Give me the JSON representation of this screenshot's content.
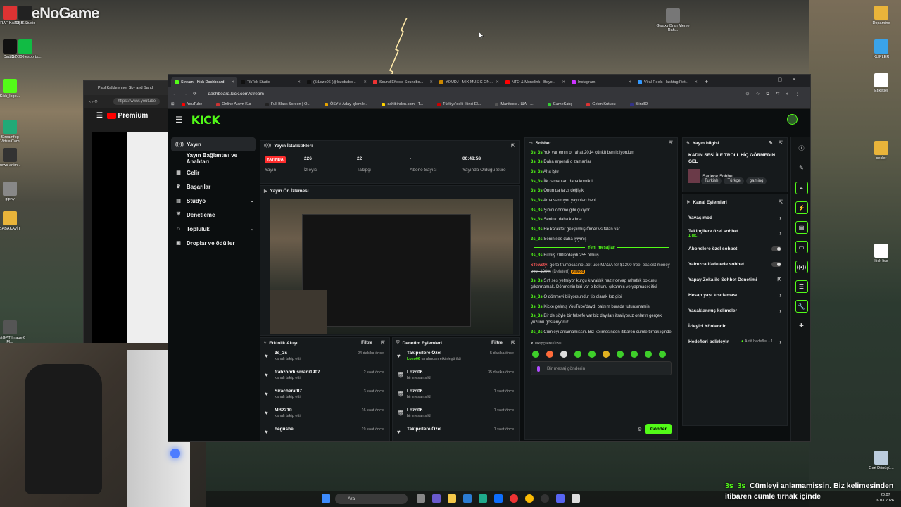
{
  "watermark": "BeNoGame",
  "desktop": {
    "left_icons": [
      {
        "label": "ETRAF KARIŞIK",
        "color": "#d33"
      },
      {
        "label": "OBS Studio",
        "color": "#222"
      },
      {
        "label": "CapCut",
        "color": "#111"
      },
      {
        "label": "LOZO06 esports...",
        "color": "#1b4"
      },
      {
        "label": "Kick_logo...",
        "color": "#53fc18"
      },
      {
        "label": "Streamfog VirtualCam",
        "color": "#2a7"
      },
      {
        "label": "news-anim...",
        "color": "#333"
      },
      {
        "label": "giphy",
        "color": "#888"
      },
      {
        "label": "BABAKAVİT",
        "color": "#e9b43a"
      },
      {
        "label": "ChatGPT Image 6 M...",
        "color": "#555"
      }
    ],
    "right_icons": [
      {
        "label": "Dopamine",
        "color": "#e9b43a"
      },
      {
        "label": "KLIPLER",
        "color": "#3aa3e9"
      },
      {
        "label": "Etiketler",
        "color": "#fff"
      },
      {
        "label": "sesler",
        "color": "#e9b43a"
      },
      {
        "label": "kick live",
        "color": "#fff"
      },
      {
        "label": "Geri Dönüşü...",
        "color": "#bcd"
      }
    ],
    "top_icon": "Galaxy Bran Meme Rah..."
  },
  "back_browser": {
    "tab": "Paul Kalkbrenner Sky and Sand",
    "url": "https://www.youtube",
    "brand": "Premium"
  },
  "browser": {
    "tabs": [
      {
        "label": "Stream - Kick Dashboard",
        "active": true,
        "color": "#53fc18"
      },
      {
        "label": "TikTok Studio",
        "active": false,
        "color": "#111"
      },
      {
        "label": "(5)Lozo06 (@lozobabo...",
        "active": false,
        "color": "#111"
      },
      {
        "label": "Sound Effects Soundbo...",
        "active": false,
        "color": "#e33"
      },
      {
        "label": "YOUDJ - MIX MUSIC ON...",
        "active": false,
        "color": "#c80"
      },
      {
        "label": "NTO & Monolink - Beyo...",
        "active": false,
        "color": "#f00"
      },
      {
        "label": "Instagram",
        "active": false,
        "color": "#c3f"
      },
      {
        "label": "Viral Reels Hashtag Ret...",
        "active": false,
        "color": "#39f"
      }
    ],
    "new_tab": "+",
    "url": "dashboard.kick.com/stream",
    "bookmarks": [
      {
        "label": "YouTube",
        "color": "#f00"
      },
      {
        "label": "Online Alarm Kur",
        "color": "#c33"
      },
      {
        "label": "Full Black Screen | O...",
        "color": "#222"
      },
      {
        "label": "ÖSYM Aday İşlemle...",
        "color": "#e9a500"
      },
      {
        "label": "sahibinden.com - T...",
        "color": "#ffd400"
      },
      {
        "label": "Türkiye'deki İkinci El...",
        "color": "#c00"
      },
      {
        "label": "Manifests / ША - ...",
        "color": "#555"
      },
      {
        "label": "GameSatış",
        "color": "#3c3"
      },
      {
        "label": "Gelen Kutusu",
        "color": "#d33"
      },
      {
        "label": "BlindID",
        "color": "#338"
      }
    ]
  },
  "kick": {
    "logo": "KICK",
    "nav": [
      {
        "label": "Yayın",
        "icon": "((•))",
        "active": true,
        "chevron": ""
      },
      {
        "label": "Yayın Bağlantısı ve Anahtarı",
        "icon": "",
        "active": false,
        "chevron": ""
      },
      {
        "label": "Gelir",
        "icon": "▦",
        "active": false,
        "chevron": ""
      },
      {
        "label": "Başarılar",
        "icon": "♛",
        "active": false,
        "chevron": ""
      },
      {
        "label": "Stüdyo",
        "icon": "▤",
        "active": false,
        "chevron": "⌄"
      },
      {
        "label": "Denetleme",
        "icon": "⛨",
        "active": false,
        "chevron": ""
      },
      {
        "label": "Topluluk",
        "icon": "☺",
        "active": false,
        "chevron": "⌄"
      },
      {
        "label": "Droplar ve ödüller",
        "icon": "▣",
        "active": false,
        "chevron": ""
      }
    ],
    "stats": {
      "title": "Yayın İstatistikleri",
      "live_label": "YAYINDA",
      "items": [
        {
          "value": "226",
          "label": "İzleyici"
        },
        {
          "value": "22",
          "label": "Takipçi"
        },
        {
          "value": "-",
          "label": "Abone Sayısı"
        },
        {
          "value": "00:48:58",
          "label": "Yayında Olduğu Süre"
        }
      ],
      "first_label": "Yayın"
    },
    "preview_title": "Yayın Ön İzlemesi",
    "activity": {
      "title": "Etkinlik Akışı",
      "filter": "Filtre",
      "rows": [
        {
          "name": "3s_3s",
          "sub": "kanalı takip etti",
          "time": "24 dakika önce"
        },
        {
          "name": "trabzondusmani1907",
          "sub": "kanalı takip etti",
          "time": "2 saat önce"
        },
        {
          "name": "Siracberat07",
          "sub": "kanalı takip etti",
          "time": "3 saat önce"
        },
        {
          "name": "MB2210",
          "sub": "kanalı takip etti",
          "time": "16 saat önce"
        },
        {
          "name": "begushe",
          "sub": "",
          "time": "19 saat önce"
        }
      ]
    },
    "moderation": {
      "title": "Denetim Eylemleri",
      "filter": "Filtre",
      "rows": [
        {
          "name": "Takipçilere Özel",
          "by": "Lozo06",
          "sub": "tarafından etkinleştirildi",
          "time": "5 dakika önce",
          "icon": "♥"
        },
        {
          "name": "Lozo06",
          "by": "",
          "sub": "bir mesajı sildi",
          "time": "35 dakika önce",
          "icon": "🗑"
        },
        {
          "name": "Lozo06",
          "by": "",
          "sub": "bir mesajı sildi",
          "time": "1 saat önce",
          "icon": "🗑"
        },
        {
          "name": "Lozo06",
          "by": "",
          "sub": "bir mesajı sildi",
          "time": "1 saat önce",
          "icon": "🗑"
        },
        {
          "name": "Takipçilere Özel",
          "by": "",
          "sub": "",
          "time": "1 saat önce",
          "icon": "♥"
        }
      ]
    },
    "chat": {
      "title": "Sohbet",
      "messages": [
        {
          "user": "3s_3s",
          "text": "Yok var emin ol rahat 2014 çünkü ben izliyordum"
        },
        {
          "user": "3s_3s",
          "text": "Daha ergendi o zamanlar"
        },
        {
          "user": "3s_3s",
          "text": "Aha işte"
        },
        {
          "user": "3s_3s",
          "text": "İlk zamanları daha komikti"
        },
        {
          "user": "3s_3s",
          "text": "Onun da tarzı değişik"
        },
        {
          "user": "3s_3s",
          "text": "Ama sarmıyor yayınları beni"
        },
        {
          "user": "3s_3s",
          "text": "Şimdi dönme gibi çıkıyor"
        },
        {
          "user": "3s_3s",
          "text": "Seninki daha kadırsı"
        },
        {
          "user": "3s_3s",
          "text": "He karakter geliştirmiş Ömer vs falan var"
        },
        {
          "user": "3s_3s",
          "text": "Senin ses daha iyiymiş"
        }
      ],
      "new_messages_label": "Yeni mesajlar",
      "messages2": [
        {
          "user": "3s_3s",
          "text": "Bitmiş 700lerdeydi 255 olmuş"
        }
      ],
      "deleted": {
        "user": "xTewsty:",
        "text": "go to trumpcasino .bet use MAGA for $1200 free, easiest money ever 100%",
        "note": "(Deleted)",
        "tag": "AI Mod"
      },
      "messages3": [
        {
          "user": "3s_3s",
          "text": "Sırf ses yetmiyor kurgu kıvraklık hazır cevap rahatlık bokunu çıkarmamak. Dönmenin biri var o bokunu çıkarmış ve yapmacık iticî"
        },
        {
          "user": "3s_3s",
          "text": "O dönmeyi biliyorsundur tip olarak kız gibi"
        },
        {
          "user": "3s_3s",
          "text": "Kicke gelmiş YouTube'daydı baktım burada tutunsmamis"
        },
        {
          "user": "3s_3s",
          "text": "Bir de şöyle bir felsefe var biz dayıları ifsaliyoruz onların gerçek yüzünü gösteriyoruz"
        },
        {
          "user": "3s_3s",
          "text": "Cümleyi anlamamissin. Biz kelimesinden itibaren cümle tırnak içinde"
        }
      ],
      "followers_only": "Takipçilere Özel",
      "input_placeholder": "Bir mesaj gönderin",
      "send": "Gönder"
    },
    "info": {
      "title": "Yayın bilgisi",
      "stream_title": "KADIN SESİ İLE TROLL HİÇ GÖRMEDİN GEL",
      "category": "Sadece Sohbet",
      "tags": [
        "Turkish",
        "Türkçe",
        "gaming"
      ]
    },
    "actions": {
      "title": "Kanal Eylemleri",
      "items": [
        {
          "label": "Yavaş mod",
          "sub": "",
          "control": "arrow",
          "side": ""
        },
        {
          "label": "Takipçilere özel sohbet",
          "sub": "1 dk.",
          "control": "arrow",
          "side": ""
        },
        {
          "label": "Abonelere özel sohbet",
          "sub": "",
          "control": "toggle",
          "side": ""
        },
        {
          "label": "Yalnızca ifadelerle sohbet",
          "sub": "",
          "control": "toggle",
          "side": ""
        },
        {
          "label": "Yapay Zeka ile Sohbet Denetimi",
          "sub": "",
          "control": "link",
          "side": ""
        },
        {
          "label": "Hesap yaşı kısıtlaması",
          "sub": "",
          "control": "arrow",
          "side": ""
        },
        {
          "label": "Yasaklanmış kelimeler",
          "sub": "",
          "control": "arrow",
          "side": ""
        },
        {
          "label": "İzleyici Yönlendir",
          "sub": "",
          "control": "none",
          "side": ""
        },
        {
          "label": "Hedefleri belirleyin",
          "sub": "",
          "control": "arrow",
          "side": "Aktif hedefler - 1"
        }
      ]
    }
  },
  "taskbar": {
    "search": "Ara",
    "time": "20:07",
    "date": "6.03.2026"
  },
  "caption": {
    "user": "3s_3s",
    "line1": "Cümleyi anlamamissin. Biz kelimesinden",
    "line2": "itibaren cümle tırnak içinde"
  }
}
